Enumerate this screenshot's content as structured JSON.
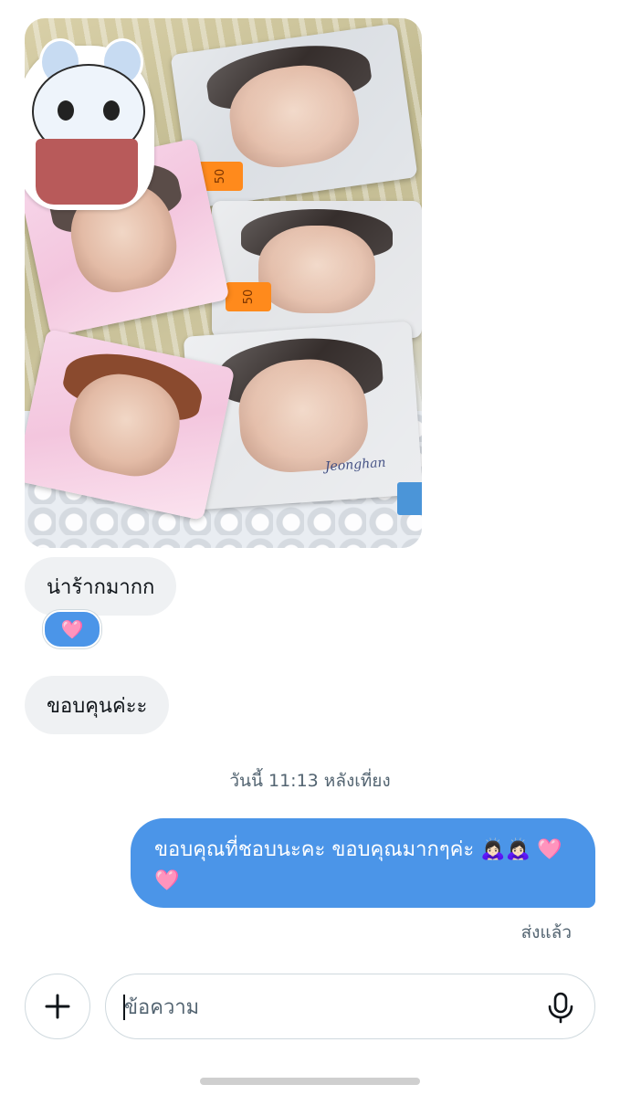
{
  "conversation": {
    "messages_received": [
      {
        "text": "น่าร้ากมากก",
        "reaction": "🩷"
      },
      {
        "text": "ขอบคุนค่ะะ"
      }
    ],
    "timestamp": "วันนี้ 11:13 หลังเที่ยง",
    "message_sent": {
      "text": "ขอบคุณที่ชอบนะคะ ขอบคุณมากๆค่ะ 🙇🏻‍♀️🙇🏻‍♀️ 🩷🩷",
      "status": "ส่งแล้ว"
    },
    "photo": {
      "price_tags": [
        "50",
        "50"
      ],
      "signature": "Jeonghan"
    }
  },
  "composer": {
    "placeholder": "ข้อความ",
    "add_icon": "plus-icon",
    "mic_icon": "microphone-icon"
  },
  "colors": {
    "accent": "#4b95e8",
    "bubble_in": "#eff1f3",
    "muted_text": "#536471"
  }
}
